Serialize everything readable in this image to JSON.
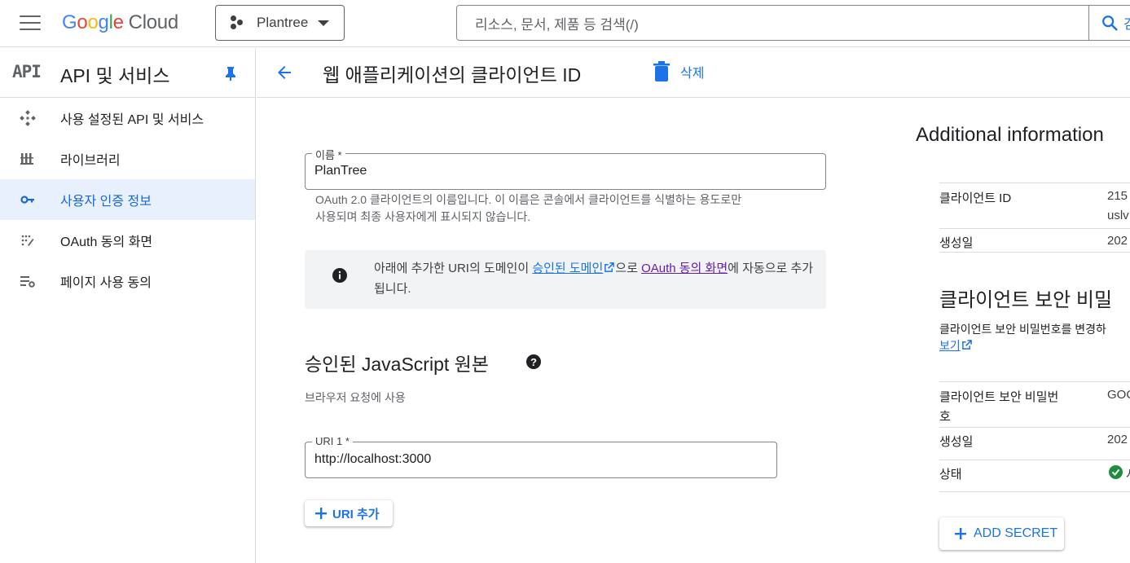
{
  "topbar": {
    "logo_letters": [
      "G",
      "o",
      "o",
      "g",
      "l",
      "e"
    ],
    "logo_suffix": "Cloud",
    "project": "Plantree",
    "search_placeholder": "리소스, 문서, 제품 등 검색(/)",
    "search_button_label": "검"
  },
  "sidebar": {
    "badge": "API",
    "title": "API 및 서비스",
    "items": [
      {
        "label": "사용 설정된 API 및 서비스",
        "icon": "diamond-dots-icon",
        "active": false
      },
      {
        "label": "라이브러리",
        "icon": "library-icon",
        "active": false
      },
      {
        "label": "사용자 인증 정보",
        "icon": "key-icon",
        "active": true
      },
      {
        "label": "OAuth 동의 화면",
        "icon": "consent-dots-icon",
        "active": false
      },
      {
        "label": "페이지 사용 동의",
        "icon": "settings-list-icon",
        "active": false
      }
    ]
  },
  "header": {
    "title": "웹 애플리케이션의 클라이언트 ID",
    "delete_label": "삭제"
  },
  "form": {
    "name_label": "이름 *",
    "name_value": "PlanTree",
    "name_hint_line1": "OAuth 2.0 클라이언트의 이름입니다. 이 이름은 콘솔에서 클라이언트를 식별하는 용도로만",
    "name_hint_line2": "사용되며 최종 사용자에게 표시되지 않습니다.",
    "info_before": "아래에 추가한 URI의 도메인이 ",
    "info_link1": "승인된 도메인",
    "info_middle": "으로 ",
    "info_link2": "OAuth 동의 화면",
    "info_after": "에 자동으로 추가됩니다.",
    "section_title": "승인된 JavaScript 원본",
    "section_hint": "브라우저 요청에 사용",
    "uri_label": "URI 1 *",
    "uri_value": "http://localhost:3000",
    "add_uri_label": "URI 추가"
  },
  "right_panel": {
    "title": "Additional information",
    "client_id_key": "클라이언트 ID",
    "client_id_val_line1": "215",
    "client_id_val_line2": "uslv",
    "created_key": "생성일",
    "created_val": "202",
    "secret_title": "클라이언트 보안 비밀",
    "secret_desc": "클라이언트 보안 비밀번호를 변경하",
    "secret_link": "보기",
    "secret_key_line1": "클라이언트 보안 비밀번",
    "secret_key_line2": "호",
    "secret_val": "GOC",
    "secret_created_key": "생성일",
    "secret_created_val": "202",
    "status_key": "상태",
    "status_val": "사",
    "add_secret_label": "ADD SECRET"
  },
  "colors": {
    "accent": "#1a73e8",
    "active_bg": "#e8f0fe",
    "divider": "#dadce0",
    "info_bg": "#f1f3f4",
    "success": "#1e8e3e"
  }
}
